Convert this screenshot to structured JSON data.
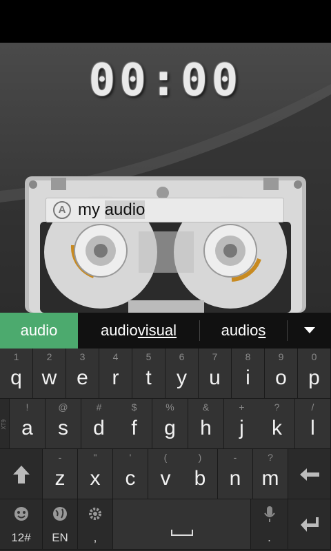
{
  "timer": "00:00",
  "input": {
    "prefix": "my ",
    "highlight": "audio",
    "icon": "a-circle-icon"
  },
  "suggestions": [
    {
      "main": "audio",
      "underlined": ""
    },
    {
      "main": "audio",
      "underlined": "visual"
    },
    {
      "main": "audio",
      "underlined": "s"
    }
  ],
  "keyboard": {
    "row1": [
      {
        "k": "q",
        "h": "1"
      },
      {
        "k": "w",
        "h": "2"
      },
      {
        "k": "e",
        "h": "3"
      },
      {
        "k": "r",
        "h": "4"
      },
      {
        "k": "t",
        "h": "5"
      },
      {
        "k": "y",
        "h": "6"
      },
      {
        "k": "u",
        "h": "7"
      },
      {
        "k": "i",
        "h": "8"
      },
      {
        "k": "o",
        "h": "9"
      },
      {
        "k": "p",
        "h": "0"
      }
    ],
    "row2": [
      {
        "k": "a",
        "h": "!"
      },
      {
        "k": "s",
        "h": "@"
      },
      {
        "k": "d",
        "h": "#"
      },
      {
        "k": "f",
        "h": "$"
      },
      {
        "k": "g",
        "h": "%"
      },
      {
        "k": "h",
        "h": "&"
      },
      {
        "k": "j",
        "h": "+"
      },
      {
        "k": "k",
        "h": "?"
      },
      {
        "k": "l",
        "h": "/"
      }
    ],
    "row3": [
      {
        "k": "z",
        "h": "-"
      },
      {
        "k": "x",
        "h": "\""
      },
      {
        "k": "c",
        "h": "'"
      },
      {
        "k": "v",
        "h": "("
      },
      {
        "k": "b",
        "h": ")"
      },
      {
        "k": "n",
        "h": "-"
      },
      {
        "k": "m",
        "h": "?"
      }
    ],
    "row2_side": "XT9",
    "symbols_label": "12#",
    "lang_label": "EN",
    "comma_label": ",",
    "period_label": "."
  }
}
